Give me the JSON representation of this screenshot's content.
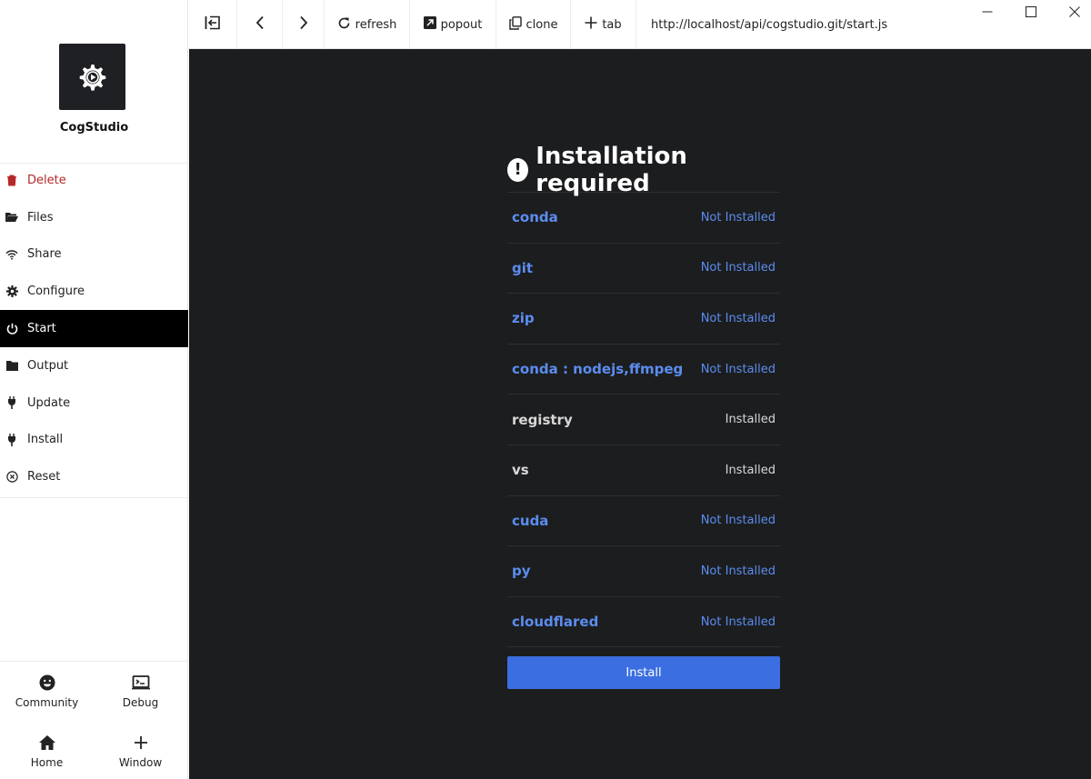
{
  "app": {
    "name": "CogStudio"
  },
  "sidebar": {
    "items": [
      {
        "label": "Delete",
        "icon": "trash-icon"
      },
      {
        "label": "Files",
        "icon": "folder-open-icon"
      },
      {
        "label": "Share",
        "icon": "wifi-icon"
      },
      {
        "label": "Configure",
        "icon": "gear-icon"
      },
      {
        "label": "Start",
        "icon": "power-icon"
      },
      {
        "label": "Output",
        "icon": "folder-icon"
      },
      {
        "label": "Update",
        "icon": "plug-icon"
      },
      {
        "label": "Install",
        "icon": "plug-icon"
      },
      {
        "label": "Reset",
        "icon": "circle-x-icon"
      }
    ],
    "active": "Start",
    "bottom": [
      {
        "label": "Community",
        "icon": "smiley-icon"
      },
      {
        "label": "Debug",
        "icon": "terminal-icon"
      },
      {
        "label": "Home",
        "icon": "home-icon"
      },
      {
        "label": "Window",
        "icon": "plus-icon"
      }
    ]
  },
  "toolbar": {
    "refresh_label": "refresh",
    "popout_label": "popout",
    "clone_label": "clone",
    "tab_label": "tab",
    "url": "http://localhost/api/cogstudio.git/start.js"
  },
  "main": {
    "title": "Installation required",
    "requirements": [
      {
        "name": "conda",
        "status": "Not Installed",
        "installed": false
      },
      {
        "name": "git",
        "status": "Not Installed",
        "installed": false
      },
      {
        "name": "zip",
        "status": "Not Installed",
        "installed": false
      },
      {
        "name": "conda : nodejs,ffmpeg",
        "status": "Not Installed",
        "installed": false
      },
      {
        "name": "registry",
        "status": "Installed",
        "installed": true
      },
      {
        "name": "vs",
        "status": "Installed",
        "installed": true
      },
      {
        "name": "cuda",
        "status": "Not Installed",
        "installed": false
      },
      {
        "name": "py",
        "status": "Not Installed",
        "installed": false
      },
      {
        "name": "cloudflared",
        "status": "Not Installed",
        "installed": false
      }
    ],
    "install_label": "Install"
  },
  "colors": {
    "accent": "#3b6ee0",
    "not_installed": "#5b8def",
    "danger": "#b4292b",
    "main_bg": "#1c1d1f"
  }
}
